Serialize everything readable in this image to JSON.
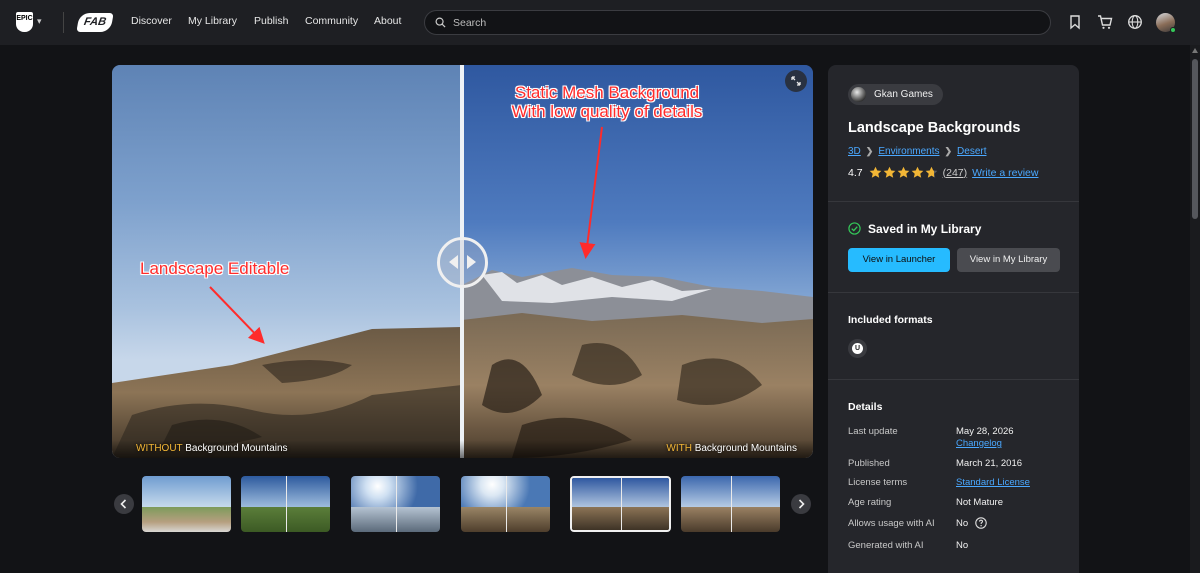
{
  "nav": {
    "epic_logo_text": "EPIC",
    "fab_logo_text": "FAB",
    "links": [
      "Discover",
      "My Library",
      "Publish",
      "Community",
      "About"
    ],
    "search_placeholder": "Search"
  },
  "gallery": {
    "annotation_right": [
      "Static Mesh Background",
      "With low quality of details"
    ],
    "annotation_left": "Landscape Editable",
    "caption_left_highlight": "WITHOUT",
    "caption_left_rest": " Background Mountains",
    "caption_right_highlight": "WITH",
    "caption_right_rest": " Background Mountains",
    "thumbnail_count": 6,
    "selected_thumbnail": 5
  },
  "product": {
    "seller": "Gkan Games",
    "title": "Landscape Backgrounds",
    "breadcrumbs": [
      "3D",
      "Environments",
      "Desert"
    ],
    "rating": "4.7",
    "rating_value": 4.7,
    "review_count": "(247)",
    "write_review": "Write a review"
  },
  "library": {
    "saved_label": "Saved in My Library",
    "view_launcher": "View in Launcher",
    "view_library": "View in My Library"
  },
  "formats": {
    "heading": "Included formats",
    "icon_letter": "U"
  },
  "details": {
    "heading": "Details",
    "last_update_label": "Last update",
    "last_update_value": "May 28, 2026",
    "changelog": "Changelog",
    "published_label": "Published",
    "published_value": "March 21, 2016",
    "license_label": "License terms",
    "license_value": "Standard License",
    "age_label": "Age rating",
    "age_value": "Not Mature",
    "ai_usage_label": "Allows usage with AI",
    "ai_usage_value": "No",
    "ai_generated_label": "Generated with AI",
    "ai_generated_value": "No"
  },
  "colors": {
    "accent": "#26bbff",
    "link": "#4aa8ff",
    "star": "#f2b636",
    "success": "#34c759"
  }
}
